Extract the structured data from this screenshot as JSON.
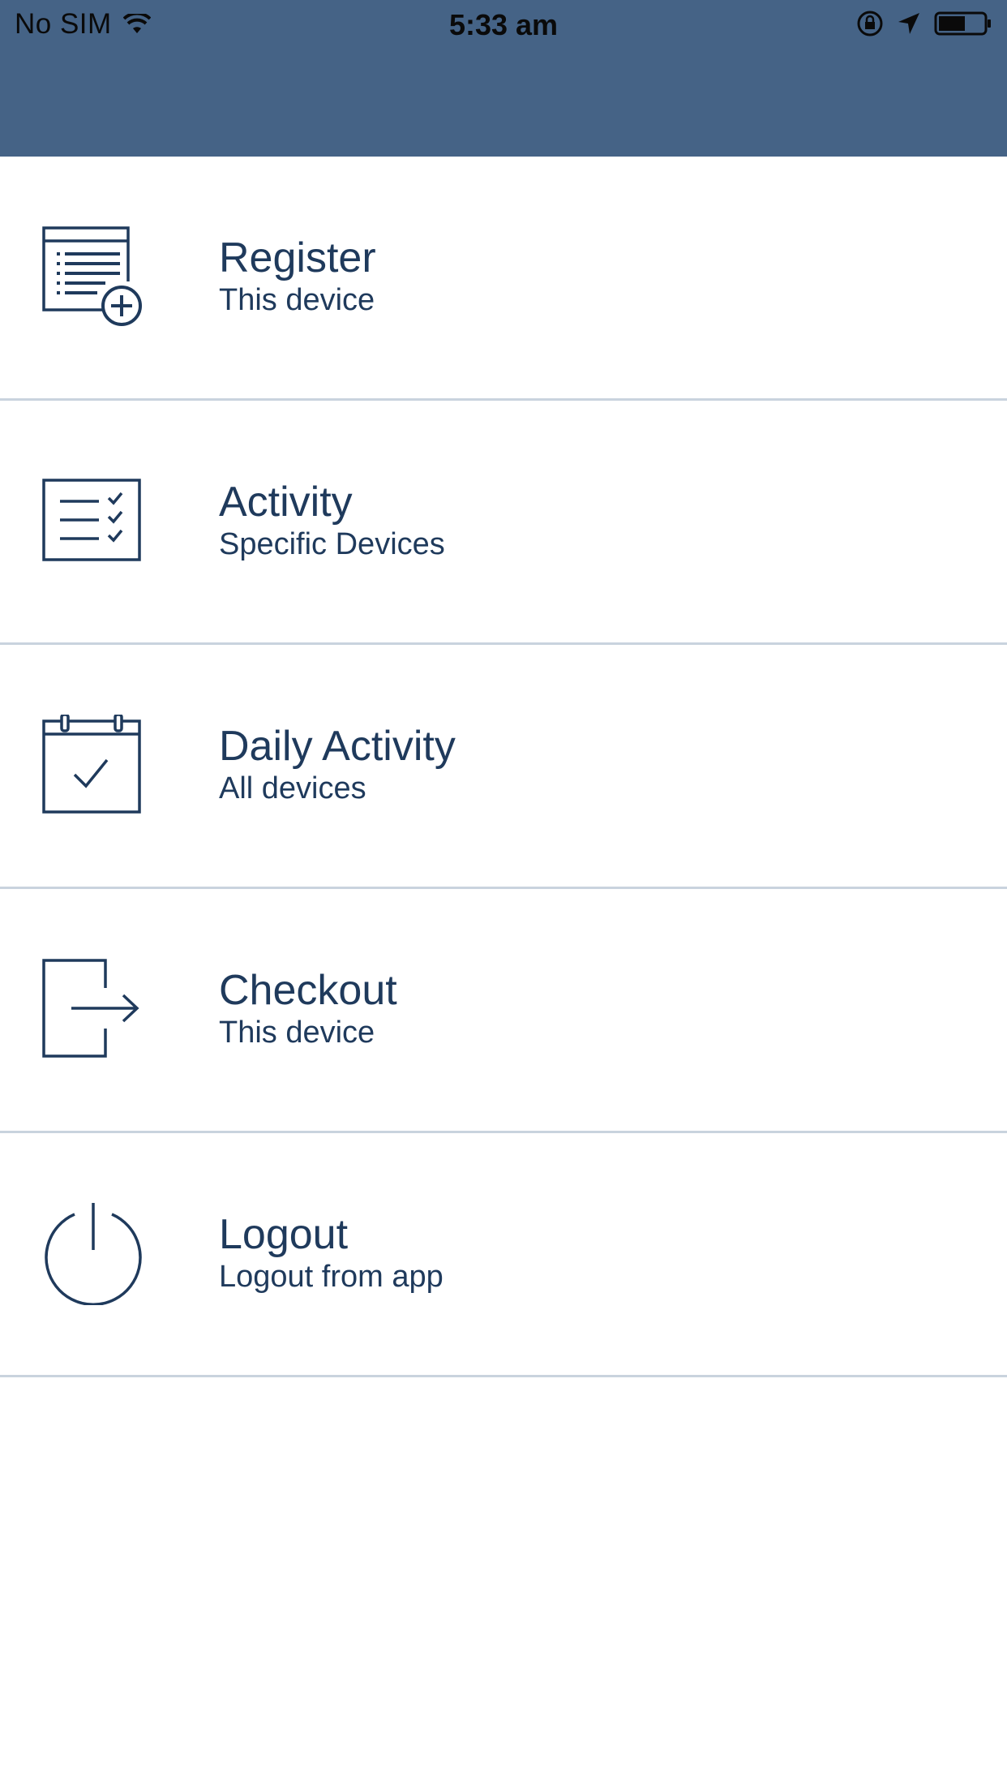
{
  "status_bar": {
    "carrier": "No SIM",
    "time": "5:33 am",
    "icons": [
      "wifi-icon",
      "rotation-lock-icon",
      "location-arrow-icon",
      "battery-icon"
    ]
  },
  "colors": {
    "header_background": "#456386",
    "text": "#1f3a5c",
    "divider": "#c9d3de"
  },
  "menu": {
    "items": [
      {
        "title": "Register",
        "subtitle": "This device",
        "icon": "register-list-plus-icon"
      },
      {
        "title": "Activity",
        "subtitle": "Specific Devices",
        "icon": "checklist-icon"
      },
      {
        "title": "Daily Activity",
        "subtitle": "All devices",
        "icon": "calendar-check-icon"
      },
      {
        "title": "Checkout",
        "subtitle": "This device",
        "icon": "exit-arrow-icon"
      },
      {
        "title": "Logout",
        "subtitle": "Logout from app",
        "icon": "power-icon"
      }
    ]
  }
}
